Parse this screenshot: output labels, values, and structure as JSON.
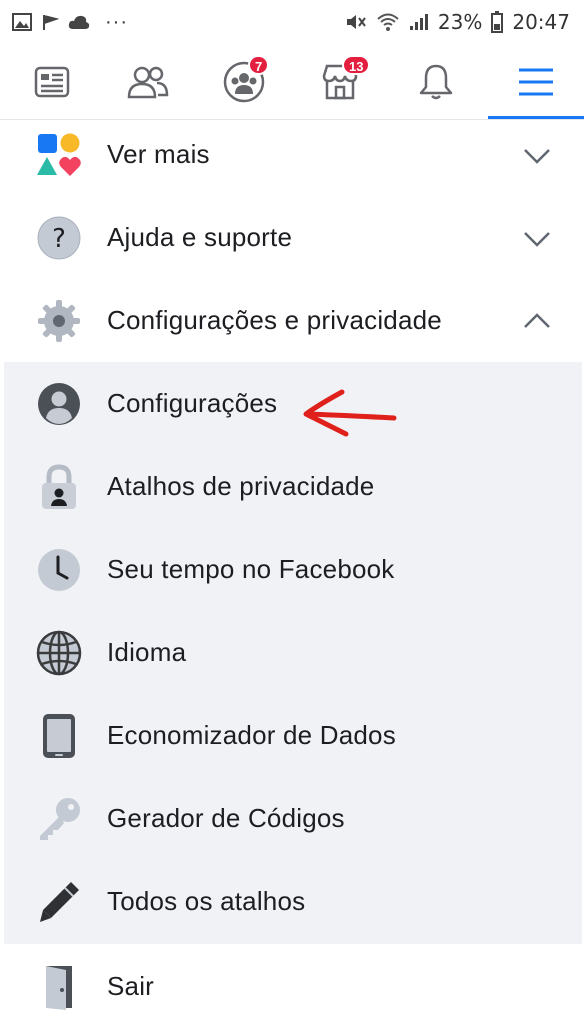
{
  "status_bar": {
    "battery": "23%",
    "time": "20:47",
    "more": "···"
  },
  "nav": {
    "items": [
      {
        "name": "feed",
        "badge": ""
      },
      {
        "name": "friends",
        "badge": ""
      },
      {
        "name": "groups",
        "badge": "7"
      },
      {
        "name": "marketplace",
        "badge": "13"
      },
      {
        "name": "notifications",
        "badge": ""
      },
      {
        "name": "menu",
        "badge": ""
      }
    ]
  },
  "menu": {
    "see_more": "Ver mais",
    "help": "Ajuda e suporte",
    "settings_privacy": "Configurações e privacidade",
    "settings_items": [
      {
        "label": "Configurações",
        "icon": "profile-icon"
      },
      {
        "label": "Atalhos de privacidade",
        "icon": "lock-icon"
      },
      {
        "label": "Seu tempo no Facebook",
        "icon": "clock-icon"
      },
      {
        "label": "Idioma",
        "icon": "globe-icon"
      },
      {
        "label": "Economizador de Dados",
        "icon": "phone-icon"
      },
      {
        "label": "Gerador de Códigos",
        "icon": "key-icon"
      },
      {
        "label": "Todos os atalhos",
        "icon": "pencil-icon"
      }
    ],
    "logout": "Sair"
  },
  "colors": {
    "accent": "#1877f2",
    "badge": "#e41e3f",
    "submenu_bg": "#f0f2f5",
    "annotation_arrow": "#e0201b"
  }
}
